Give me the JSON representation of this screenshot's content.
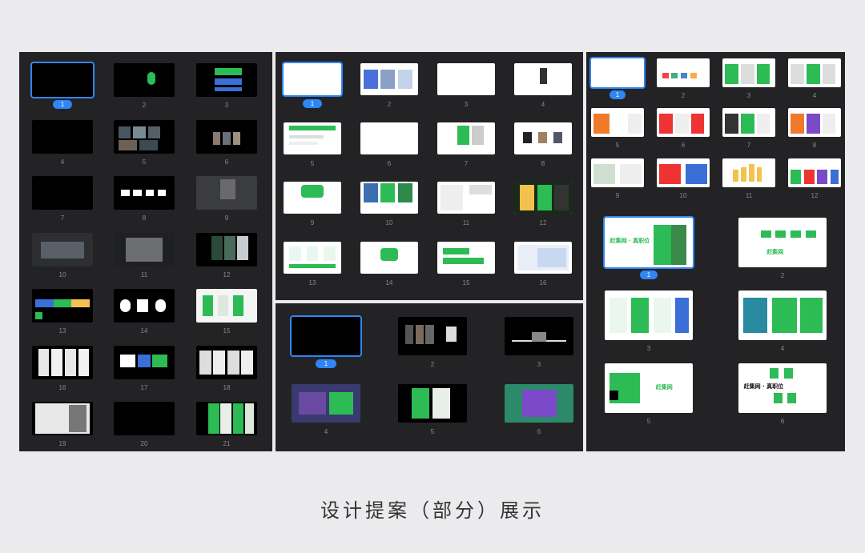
{
  "caption": "设计提案（部分）展示",
  "panels": [
    {
      "id": "left",
      "slide_count": 21,
      "selected": 1,
      "slide_numbers": [
        "1",
        "2",
        "3",
        "4",
        "5",
        "6",
        "7",
        "8",
        "9",
        "10",
        "11",
        "12",
        "13",
        "14",
        "15",
        "16",
        "17",
        "18",
        "19",
        "20",
        "21"
      ]
    },
    {
      "id": "middle-top",
      "slide_count": 16,
      "selected": 1,
      "slide_numbers": [
        "1",
        "2",
        "3",
        "4",
        "5",
        "6",
        "7",
        "8",
        "9",
        "10",
        "11",
        "12",
        "13",
        "14",
        "15",
        "16"
      ]
    },
    {
      "id": "middle-bottom",
      "slide_count": 6,
      "selected": 1,
      "slide_numbers": [
        "1",
        "2",
        "3",
        "4",
        "5",
        "6"
      ]
    },
    {
      "id": "right-top",
      "slide_count": 12,
      "selected": 1,
      "slide_numbers": [
        "1",
        "2",
        "3",
        "4",
        "5",
        "6",
        "7",
        "8",
        "9",
        "10",
        "11",
        "12"
      ]
    },
    {
      "id": "right-bottom",
      "slide_count": 6,
      "selected": 1,
      "slide_numbers": [
        "1",
        "2",
        "3",
        "4",
        "5",
        "6"
      ]
    }
  ],
  "slide_texts": {
    "right_bottom_1_brand": "赶集网 · 真职位",
    "right_bottom_2_brand": "赶集网",
    "right_bottom_5_brand": "赶集网",
    "right_bottom_6_brand": "赶集网 · 真职位"
  },
  "colors": {
    "panel_bg": "#232325",
    "page_bg": "#ebebed",
    "selection": "#2f86f6",
    "brand_green": "#2dbb55"
  }
}
